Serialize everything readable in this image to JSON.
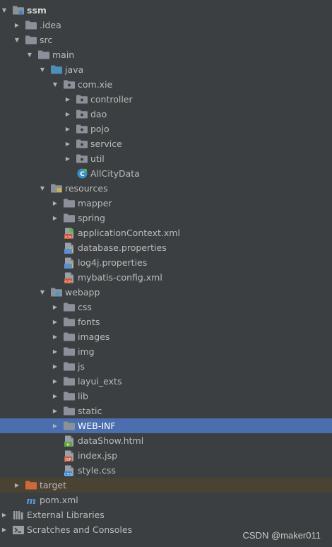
{
  "colors": {
    "background": "#3c3f41",
    "selection": "#4b6eaf",
    "excluded": "#4a4334",
    "folder": "#8b9199",
    "source_folder": "#4a90b8",
    "excluded_folder": "#cc6a3b"
  },
  "tree": [
    {
      "label": "ssm",
      "indent": 0,
      "arrow": "down",
      "icon": "module-folder-icon",
      "bold": true
    },
    {
      "label": ".idea",
      "indent": 1,
      "arrow": "right",
      "icon": "folder-icon"
    },
    {
      "label": "src",
      "indent": 1,
      "arrow": "down",
      "icon": "folder-icon"
    },
    {
      "label": "main",
      "indent": 2,
      "arrow": "down",
      "icon": "folder-icon"
    },
    {
      "label": "java",
      "indent": 3,
      "arrow": "down",
      "icon": "source-folder-icon"
    },
    {
      "label": "com.xie",
      "indent": 4,
      "arrow": "down",
      "icon": "package-icon"
    },
    {
      "label": "controller",
      "indent": 5,
      "arrow": "right",
      "icon": "package-icon"
    },
    {
      "label": "dao",
      "indent": 5,
      "arrow": "right",
      "icon": "package-icon"
    },
    {
      "label": "pojo",
      "indent": 5,
      "arrow": "right",
      "icon": "package-icon"
    },
    {
      "label": "service",
      "indent": 5,
      "arrow": "right",
      "icon": "package-icon"
    },
    {
      "label": "util",
      "indent": 5,
      "arrow": "right",
      "icon": "package-icon"
    },
    {
      "label": "AllCityData",
      "indent": 5,
      "arrow": "none",
      "icon": "java-class-icon"
    },
    {
      "label": "resources",
      "indent": 3,
      "arrow": "down",
      "icon": "resources-folder-icon"
    },
    {
      "label": "mapper",
      "indent": 4,
      "arrow": "right",
      "icon": "folder-icon"
    },
    {
      "label": "spring",
      "indent": 4,
      "arrow": "right",
      "icon": "folder-icon"
    },
    {
      "label": "applicationContext.xml",
      "indent": 4,
      "arrow": "none",
      "icon": "spring-xml-icon"
    },
    {
      "label": "database.properties",
      "indent": 4,
      "arrow": "none",
      "icon": "properties-file-icon"
    },
    {
      "label": "log4j.properties",
      "indent": 4,
      "arrow": "none",
      "icon": "properties-file-icon"
    },
    {
      "label": "mybatis-config.xml",
      "indent": 4,
      "arrow": "none",
      "icon": "xml-file-icon"
    },
    {
      "label": "webapp",
      "indent": 3,
      "arrow": "down",
      "icon": "web-folder-icon"
    },
    {
      "label": "css",
      "indent": 4,
      "arrow": "right",
      "icon": "folder-icon"
    },
    {
      "label": "fonts",
      "indent": 4,
      "arrow": "right",
      "icon": "folder-icon"
    },
    {
      "label": "images",
      "indent": 4,
      "arrow": "right",
      "icon": "folder-icon"
    },
    {
      "label": "img",
      "indent": 4,
      "arrow": "right",
      "icon": "folder-icon"
    },
    {
      "label": "js",
      "indent": 4,
      "arrow": "right",
      "icon": "folder-icon"
    },
    {
      "label": "layui_exts",
      "indent": 4,
      "arrow": "right",
      "icon": "folder-icon"
    },
    {
      "label": "lib",
      "indent": 4,
      "arrow": "right",
      "icon": "folder-icon"
    },
    {
      "label": "static",
      "indent": 4,
      "arrow": "right",
      "icon": "folder-icon"
    },
    {
      "label": "WEB-INF",
      "indent": 4,
      "arrow": "right",
      "icon": "folder-icon",
      "selected": true
    },
    {
      "label": "dataShow.html",
      "indent": 4,
      "arrow": "none",
      "icon": "html-file-icon"
    },
    {
      "label": "index.jsp",
      "indent": 4,
      "arrow": "none",
      "icon": "jsp-file-icon"
    },
    {
      "label": "style.css",
      "indent": 4,
      "arrow": "none",
      "icon": "css-file-icon"
    },
    {
      "label": "target",
      "indent": 1,
      "arrow": "right",
      "icon": "excluded-folder-icon",
      "excluded": true
    },
    {
      "label": "pom.xml",
      "indent": 1,
      "arrow": "none",
      "icon": "maven-icon"
    },
    {
      "label": "External Libraries",
      "indent": 0,
      "arrow": "right",
      "icon": "libraries-icon"
    },
    {
      "label": "Scratches and Consoles",
      "indent": 0,
      "arrow": "right",
      "icon": "scratches-icon"
    }
  ],
  "watermark": "CSDN @maker011"
}
